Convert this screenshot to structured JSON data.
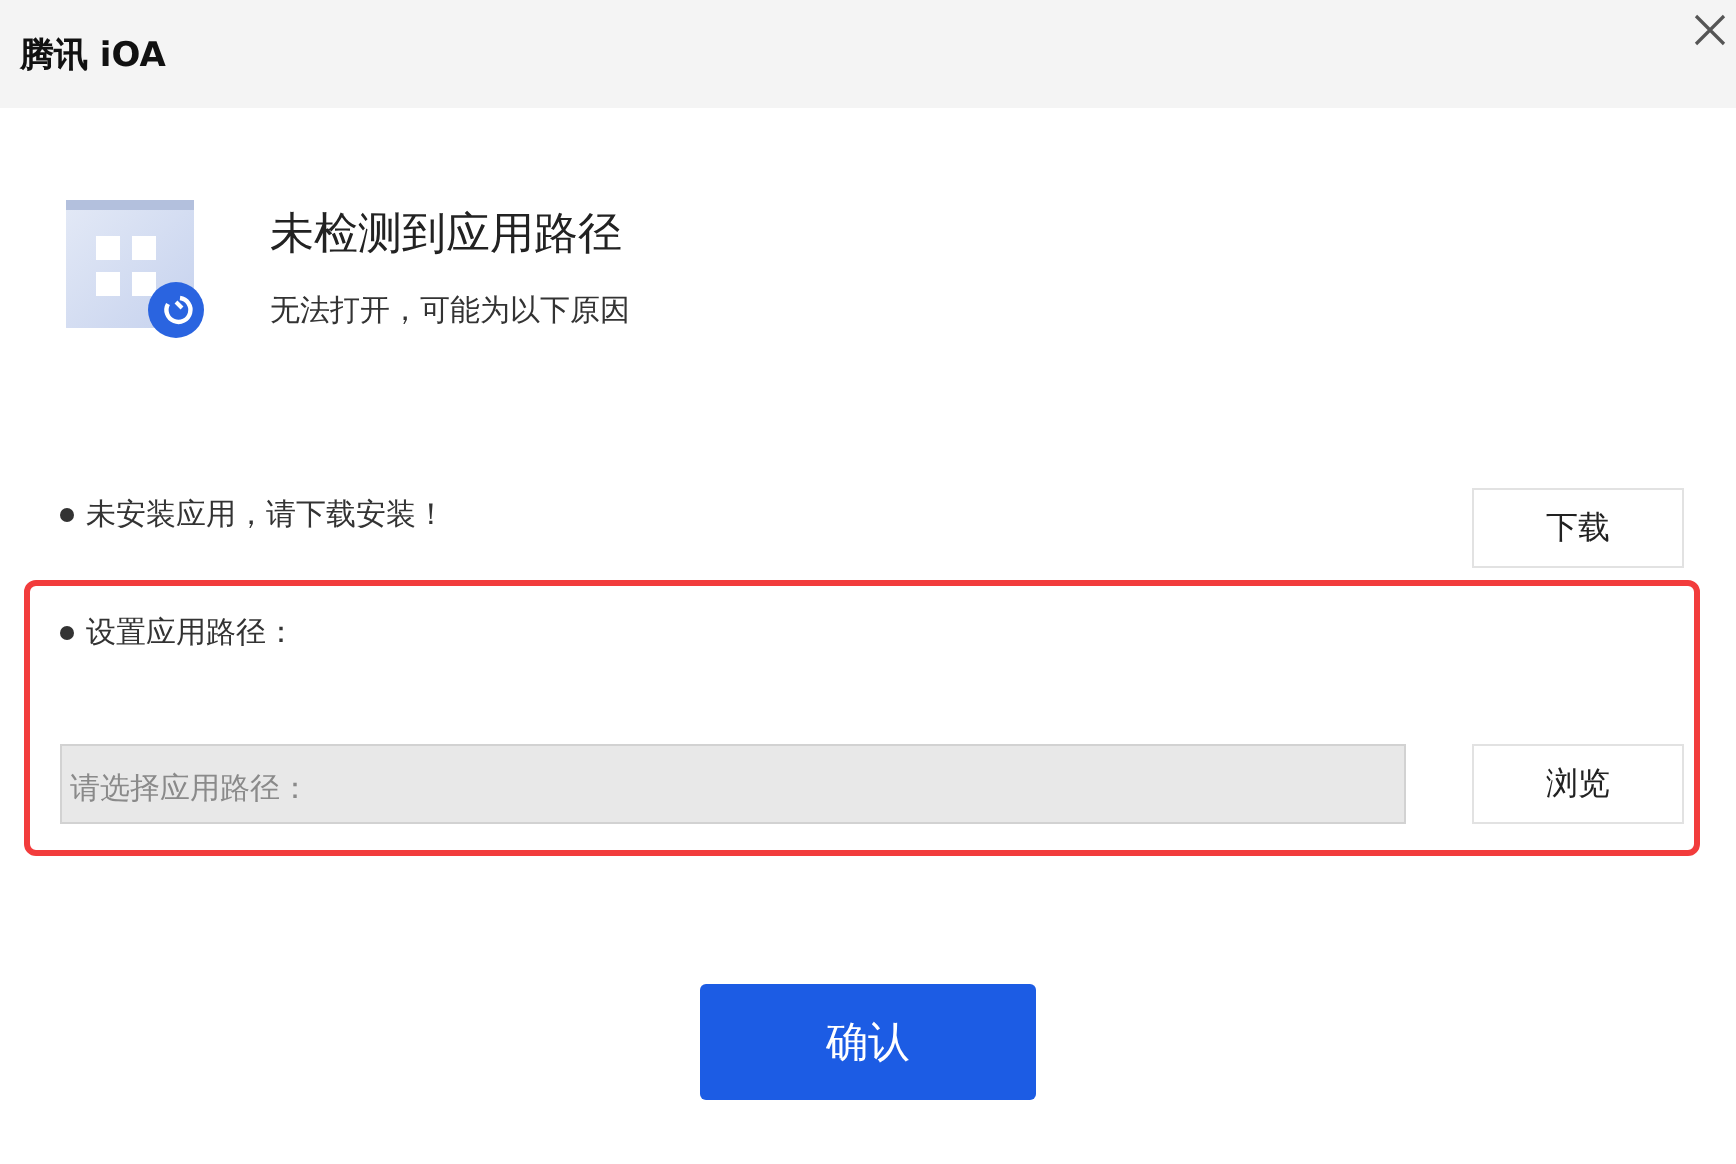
{
  "window": {
    "title": "腾讯 iOA"
  },
  "header": {
    "title": "未检测到应用路径",
    "subtitle": "无法打开，可能为以下原因"
  },
  "reasons": [
    {
      "kind": "action",
      "text": "未安装应用，请下载安装！",
      "button": "下载",
      "highlighted": false
    },
    {
      "kind": "path",
      "text": "设置应用路径：",
      "placeholder": "请选择应用路径：",
      "button": "浏览",
      "highlighted": true
    }
  ],
  "confirm_button": "确认"
}
